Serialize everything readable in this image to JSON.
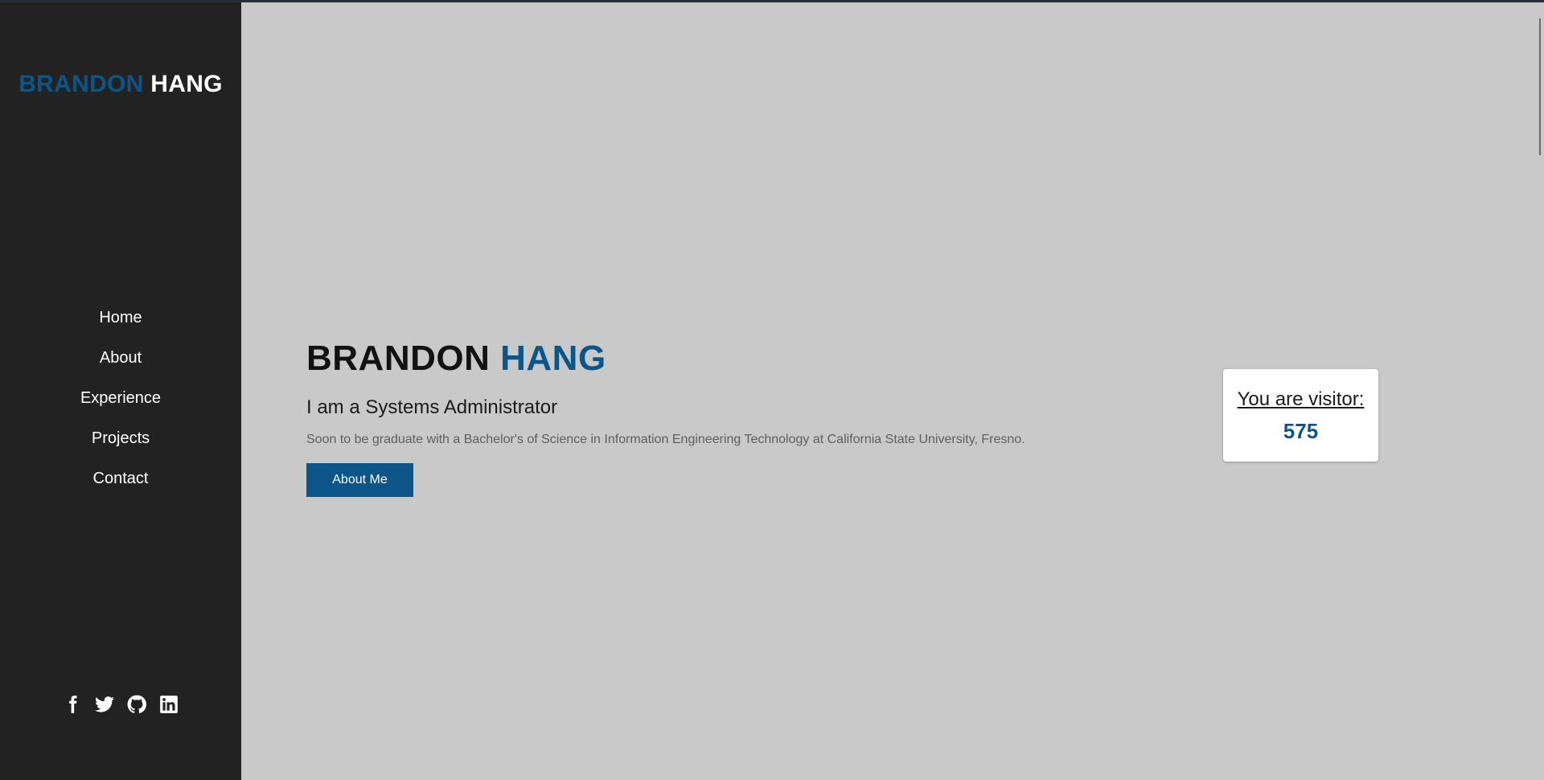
{
  "sidebar": {
    "brand_first": "BRANDON",
    "brand_last": "HANG",
    "nav": [
      "Home",
      "About",
      "Experience",
      "Projects",
      "Contact"
    ],
    "social_icons": [
      "facebook-icon",
      "twitter-icon",
      "github-icon",
      "linkedin-icon"
    ]
  },
  "hero": {
    "name_first": "BRANDON",
    "name_last": "HANG",
    "role": "I am a Systems Administrator",
    "description": "Soon to be graduate with a Bachelor's of Science in Information Engineering Technology at California State University, Fresno.",
    "button_label": "About Me"
  },
  "visitor": {
    "label": "You are visitor:",
    "count": "575"
  },
  "colors": {
    "accent": "#0b5588",
    "sidebar_bg": "#222222",
    "main_bg": "#c9c9c9"
  }
}
